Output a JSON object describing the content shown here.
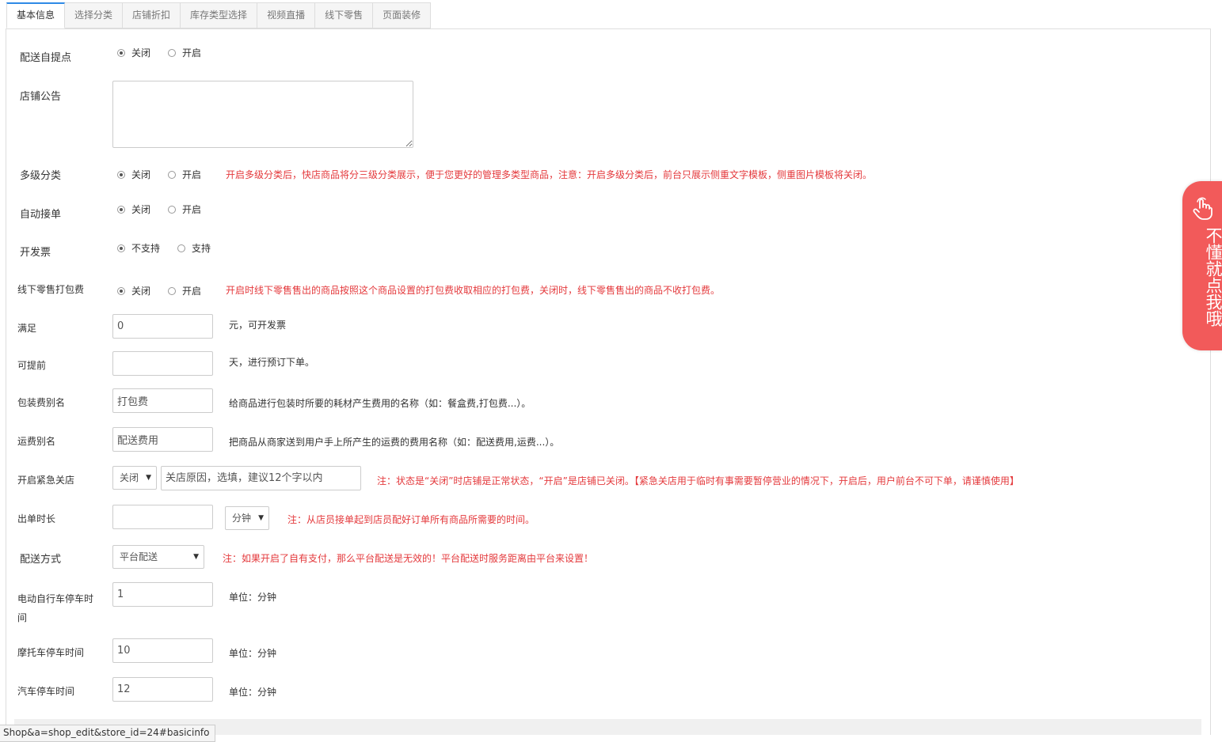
{
  "tabs": [
    "基本信息",
    "选择分类",
    "店铺折扣",
    "库存类型选择",
    "视频直播",
    "线下零售",
    "页面装修"
  ],
  "fields": {
    "pickup": {
      "label": "配送自提点",
      "options": [
        "关闭",
        "开启"
      ],
      "selected": "关闭"
    },
    "notice": {
      "label": "店铺公告",
      "value": ""
    },
    "multi_category": {
      "label": "多级分类",
      "options": [
        "关闭",
        "开启"
      ],
      "selected": "关闭",
      "note": "开启多级分类后，快店商品将分三级分类展示，便于您更好的管理多类型商品，注意：开启多级分类后，前台只展示侧重文字模板，侧重图片模板将关闭。"
    },
    "auto_accept": {
      "label": "自动接单",
      "options": [
        "关闭",
        "开启"
      ],
      "selected": "关闭"
    },
    "invoice": {
      "label": "开发票",
      "options": [
        "不支持",
        "支持"
      ],
      "selected": "不支持"
    },
    "offline_pack_fee": {
      "label": "线下零售打包费",
      "options": [
        "关闭",
        "开启"
      ],
      "selected": "关闭",
      "note": "开启时线下零售售出的商品按照这个商品设置的打包费收取相应的打包费，关闭时，线下零售售出的商品不收打包费。"
    },
    "invoice_min": {
      "label": "满足",
      "value": "0",
      "suffix": "元，可开发票"
    },
    "advance_days": {
      "label": "可提前",
      "value": "",
      "suffix": "天，进行预订下单。"
    },
    "pack_fee_alias": {
      "label": "包装费别名",
      "value": "打包费",
      "suffix": "给商品进行包装时所要的耗材产生费用的名称（如：餐盒费,打包费...）。"
    },
    "freight_alias": {
      "label": "运费别名",
      "value": "配送费用",
      "suffix": "把商品从商家送到用户手上所产生的运费的费用名称（如：配送费用,运费...）。"
    },
    "emergency_close": {
      "label": "开启紧急关店",
      "select": "关闭",
      "placeholder": "关店原因，选填，建议12个字以内",
      "note": "注：状态是“关闭”时店铺是正常状态，“开启”是店铺已关闭。【紧急关店用于临时有事需要暂停营业的情况下，开启后，用户前台不可下单，请谨慎使用】"
    },
    "prep_time": {
      "label": "出单时长",
      "value": "",
      "unit": "分钟",
      "note": "注：从店员接单起到店员配好订单所有商品所需要的时间。"
    },
    "delivery_method": {
      "label": "配送方式",
      "select": "平台配送",
      "note": "注：如果开启了自有支付，那么平台配送是无效的！平台配送时服务距离由平台来设置！"
    },
    "ebike_parking": {
      "label": "电动自行车停车时间",
      "value": "1",
      "suffix": "单位：分钟"
    },
    "moto_parking": {
      "label": "摩托车停车时间",
      "value": "10",
      "suffix": "单位：分钟"
    },
    "car_parking": {
      "label": "汽车停车时间",
      "value": "12",
      "suffix": "单位：分钟"
    }
  },
  "help_float": {
    "text": "不懂就点我哦",
    "icon": "hand-pointer-icon"
  },
  "status_url": "Shop&a=shop_edit&store_id=24#basicinfo",
  "colors": {
    "accent": "#2e8ae6",
    "note_red": "#e4393c",
    "help_bg": "#f25a5a"
  }
}
